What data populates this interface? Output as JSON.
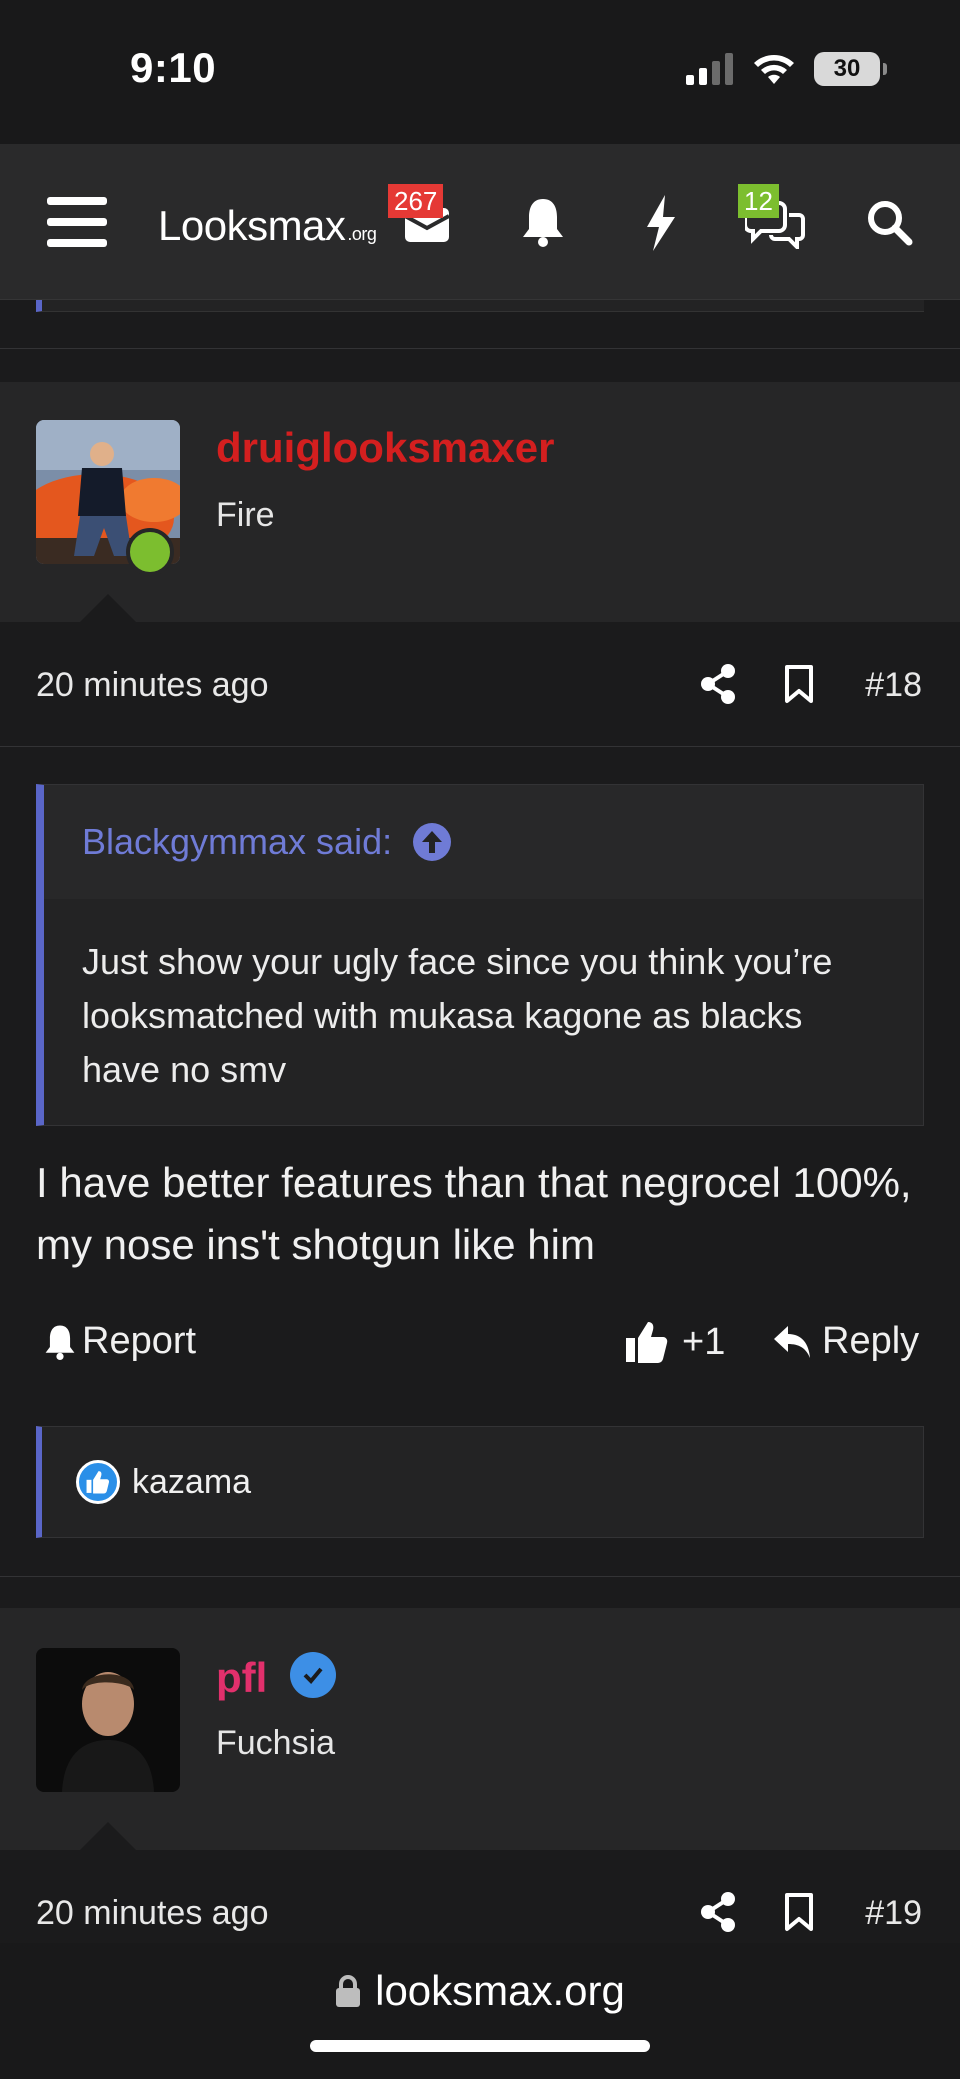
{
  "status_bar": {
    "time": "9:10",
    "battery": "30"
  },
  "nav": {
    "logo_main": "Looksmax",
    "logo_suffix": ".org",
    "inbox_badge": "267",
    "conversations_badge": "12",
    "icons": [
      "menu-icon",
      "inbox-icon",
      "bell-icon",
      "lightning-icon",
      "chat-icon",
      "search-icon"
    ]
  },
  "posts": [
    {
      "username": "druiglooksmaxer",
      "user_title": "Fire",
      "username_color": "#d41f1f",
      "date": "20 minutes ago",
      "number": "#18",
      "quote": {
        "author": "Blackgymmax said:",
        "text": "Just show your ugly face since you think you’re looksmatched with mukasa kagone as blacks have no smv"
      },
      "body": "I have better features than that negrocel 100%, my nose ins't shotgun like him",
      "actions": {
        "report": "Report",
        "like_count": "+1",
        "reply": "Reply"
      },
      "reactions": {
        "users": "kazama"
      }
    },
    {
      "username": "pfl",
      "user_title": "Fuchsia",
      "username_color": "#e2306c",
      "date": "20 minutes ago",
      "number": "#19"
    }
  ],
  "browser": {
    "url": "looksmax.org"
  },
  "colors": {
    "accent": "#5a66c8",
    "quote_author": "#6f7bd6",
    "online": "#7cbe2f",
    "badge_red": "#e53935"
  }
}
